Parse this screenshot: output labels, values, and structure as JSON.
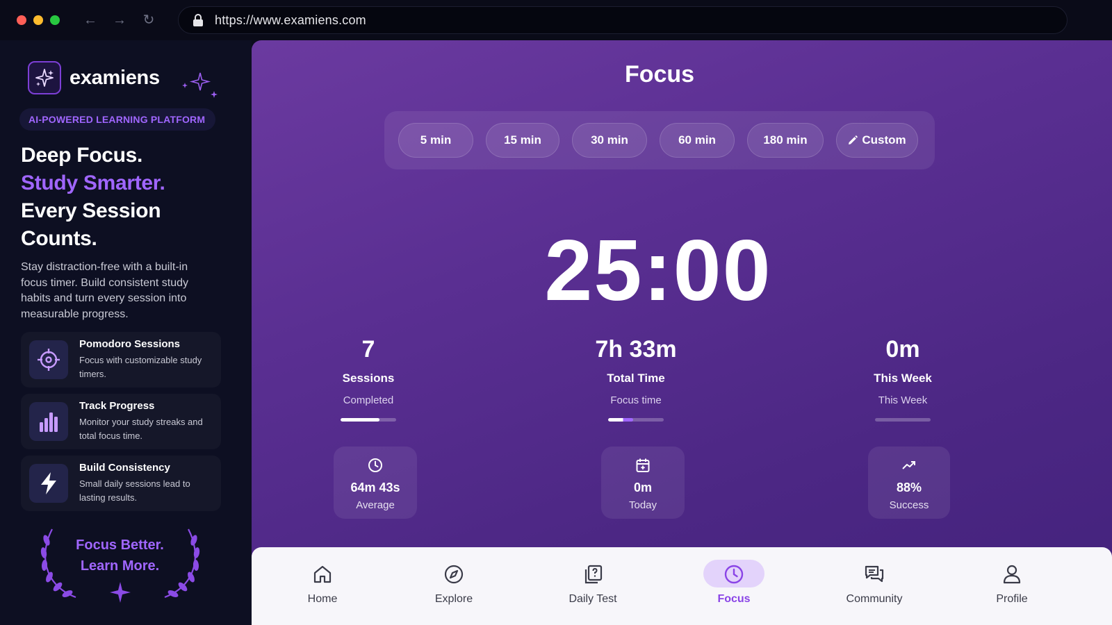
{
  "browser": {
    "url": "https://www.examiens.com",
    "controls": {
      "back": "←",
      "forward": "→",
      "reload": "↻"
    }
  },
  "sidebar": {
    "brand": "examiens",
    "tagline": "AI-POWERED LEARNING PLATFORM",
    "headline": {
      "line1": "Deep Focus.",
      "line2": "Study Smarter.",
      "line3": "Every Session",
      "line4": "Counts."
    },
    "description": "Stay distraction-free with a built-in focus timer. Build consistent study habits and turn every session into measurable progress.",
    "features": [
      {
        "title": "Pomodoro Sessions",
        "desc": "Focus with customizable study timers.",
        "icon": "crosshair-icon"
      },
      {
        "title": "Track Progress",
        "desc": "Monitor your study streaks and total focus time.",
        "icon": "bar-chart-icon"
      },
      {
        "title": "Build Consistency",
        "desc": "Small daily sessions lead to lasting results.",
        "icon": "lightning-icon"
      }
    ],
    "laurel": {
      "line1": "Focus Better.",
      "line2": "Learn More."
    }
  },
  "main": {
    "title": "Focus",
    "presets": [
      "5 min",
      "15 min",
      "30 min",
      "60 min",
      "180 min",
      "Custom"
    ],
    "timer": "25:00",
    "stats": [
      {
        "value": "7",
        "label": "Sessions",
        "sub": "Completed",
        "progress": 0.7
      },
      {
        "value": "7h 33m",
        "label": "Total Time",
        "sub": "Focus time",
        "progress": 0.45
      },
      {
        "value": "0m",
        "label": "This Week",
        "sub": "This Week",
        "progress": 0
      }
    ],
    "mini_cards": [
      {
        "value": "64m 43s",
        "label": "Average",
        "icon": "clock-icon"
      },
      {
        "value": "0m",
        "label": "Today",
        "icon": "calendar-icon"
      },
      {
        "value": "88%",
        "label": "Success",
        "icon": "trend-up-icon"
      }
    ]
  },
  "bottom_nav": {
    "items": [
      "Home",
      "Explore",
      "Daily Test",
      "Focus",
      "Community",
      "Profile"
    ],
    "active": "Focus"
  },
  "colors": {
    "accent": "#a066ff",
    "active_nav": "#8a44e6",
    "panel_top": "#6b3aa0",
    "panel_bottom": "#43227c",
    "sidebar_bg": "#0d0f22"
  }
}
